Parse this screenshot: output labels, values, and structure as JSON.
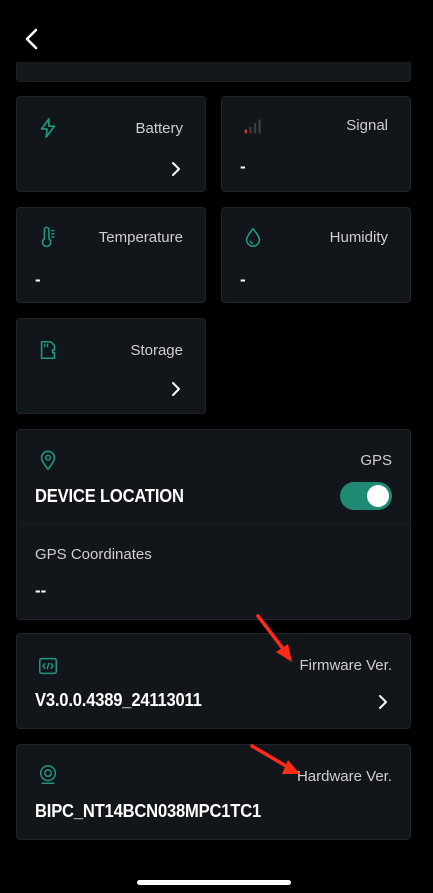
{
  "cards": {
    "battery": {
      "label": "Battery"
    },
    "signal": {
      "label": "Signal",
      "value": "-"
    },
    "temperature": {
      "label": "Temperature",
      "value": "-"
    },
    "humidity": {
      "label": "Humidity",
      "value": "-"
    },
    "storage": {
      "label": "Storage"
    }
  },
  "location": {
    "gps_label": "GPS",
    "title": "DEVICE LOCATION",
    "toggle_on": true,
    "coords_label": "GPS Coordinates",
    "coords_value": "--"
  },
  "firmware": {
    "label": "Firmware Ver.",
    "value": "V3.0.0.4389_24113011"
  },
  "hardware": {
    "label": "Hardware Ver.",
    "value": "BIPC_NT14BCN038MPC1TC1"
  },
  "colors": {
    "accent": "#1f8a74",
    "arrow": "#ff2a1a",
    "card_bg": "#121519"
  },
  "icons": {
    "back": "chevron-left-icon",
    "battery": "lightning-icon",
    "signal": "signal-bars-icon",
    "temperature": "thermometer-icon",
    "humidity": "water-drop-icon",
    "storage": "sd-card-icon",
    "location": "map-pin-icon",
    "firmware": "code-icon",
    "hardware": "camera-lens-icon"
  }
}
